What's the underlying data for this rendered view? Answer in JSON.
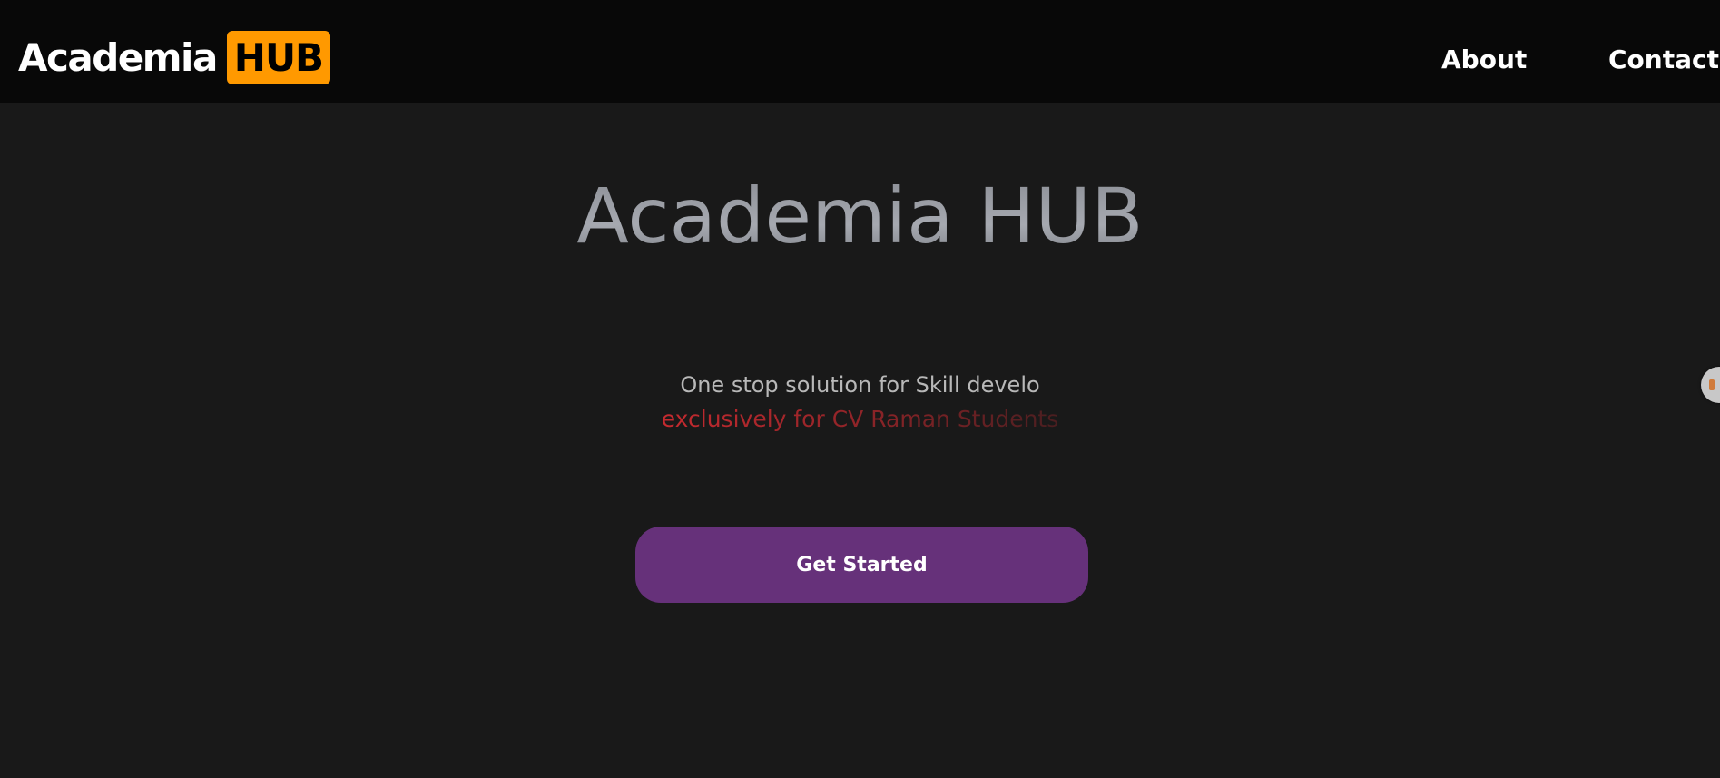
{
  "navbar": {
    "logo_text": "Academia",
    "logo_badge": "HUB",
    "links": {
      "about": "About",
      "contact": "Contact"
    }
  },
  "hero": {
    "title": "Academia HUB",
    "tagline": "One stop solution for Skill develo",
    "subtag": "exclusively for CV Raman Students",
    "cta_label": "Get Started"
  },
  "colors": {
    "background": "#191919",
    "navbar": "#080808",
    "logo_badge": "#ff9900",
    "cta": "#66317a",
    "subtag_red": "#c62a2f"
  },
  "icons": {
    "side_widget": "floating-widget-icon"
  }
}
